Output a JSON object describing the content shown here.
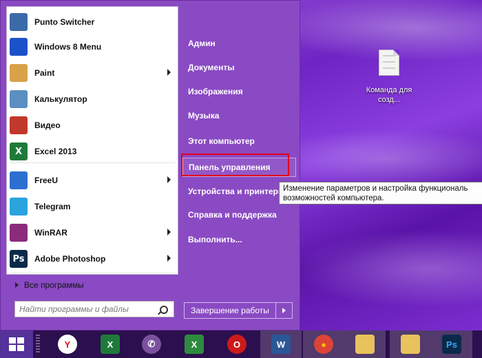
{
  "desktop": {
    "file_icon": "text-file-icon",
    "file_label": "Команда для созд..."
  },
  "start_menu": {
    "programs": [
      {
        "label": "Punto Switcher",
        "icon": "punto-switcher-icon",
        "color": "#3a6aa8",
        "glyph": "",
        "submenu": false
      },
      {
        "label": "Windows 8 Menu",
        "icon": "windows8-menu-icon",
        "color": "#1b52c9",
        "glyph": "",
        "submenu": false
      },
      {
        "label": "Paint",
        "icon": "paint-palette-icon",
        "color": "#d9a24a",
        "glyph": "",
        "submenu": true
      },
      {
        "label": "Калькулятор",
        "icon": "calculator-icon",
        "color": "#5a8fc0",
        "glyph": "",
        "submenu": false
      },
      {
        "label": "Видео",
        "icon": "video-icon",
        "color": "#c0392b",
        "glyph": "",
        "submenu": false
      },
      {
        "label": "Excel 2013",
        "icon": "excel-icon",
        "color": "#1f7a3a",
        "glyph": "X",
        "submenu": false
      },
      {
        "label": "FreeU",
        "icon": "freeu-icon",
        "color": "#2d6fd1",
        "glyph": "",
        "submenu": true
      },
      {
        "label": "Telegram",
        "icon": "telegram-icon",
        "color": "#2aa3df",
        "glyph": "",
        "submenu": false
      },
      {
        "label": "WinRAR",
        "icon": "winrar-icon",
        "color": "#8b2b7b",
        "glyph": "",
        "submenu": true
      },
      {
        "label": "Adobe Photoshop",
        "icon": "photoshop-icon",
        "color": "#0b2a4a",
        "glyph": "Ps",
        "submenu": true
      }
    ],
    "all_programs_label": "Все программы",
    "search_placeholder": "Найти программы и файлы",
    "right_items": [
      {
        "label": "Админ",
        "name": "admin"
      },
      {
        "label": "Документы",
        "name": "documents"
      },
      {
        "label": "Изображения",
        "name": "pictures"
      },
      {
        "label": "Музыка",
        "name": "music"
      },
      {
        "label": "Этот компьютер",
        "name": "this-pc"
      },
      {
        "label": "Панель управления",
        "name": "control-panel"
      },
      {
        "label": "Устройства и принтеры",
        "name": "devices-printers"
      },
      {
        "label": "Справка и поддержка",
        "name": "help-support"
      },
      {
        "label": "Выполнить...",
        "name": "run"
      }
    ],
    "highlighted_item": "Панель управления",
    "tooltip_line1": "Изменение параметров и настройка функциональ",
    "tooltip_line2": "возможностей компьютера.",
    "shutdown_label": "Завершение работы"
  },
  "taskbar": {
    "start_icon": "windows-logo-icon",
    "apps": [
      {
        "name": "yandex-browser",
        "icon": "yandex-browser-icon",
        "color": "#ffffff",
        "glyph": "Y",
        "glyph_color": "#e3001b"
      },
      {
        "name": "excel",
        "icon": "excel-icon",
        "color": "#1f7a3a",
        "glyph": "X",
        "glyph_color": "#ffffff"
      },
      {
        "name": "viber",
        "icon": "viber-icon",
        "color": "#7b519d",
        "glyph": "✆",
        "glyph_color": "#ffffff"
      },
      {
        "name": "excel-2",
        "icon": "excel-icon",
        "color": "#2e8b3e",
        "glyph": "X",
        "glyph_color": "#ffffff"
      },
      {
        "name": "opera",
        "icon": "opera-icon",
        "color": "#cc1b1b",
        "glyph": "O",
        "glyph_color": "#ffffff"
      },
      {
        "name": "word",
        "icon": "word-icon",
        "color": "#2b5797",
        "glyph": "W",
        "glyph_color": "#ffffff"
      },
      {
        "name": "chrome",
        "icon": "chrome-icon",
        "color": "#db4437",
        "glyph": "●",
        "glyph_color": "#fbbc05"
      },
      {
        "name": "file-explorer",
        "icon": "folder-icon",
        "color": "#e8c25c",
        "glyph": "",
        "glyph_color": "#ffffff"
      },
      {
        "name": "file-explorer-2",
        "icon": "folder-icon",
        "color": "#e8c25c",
        "glyph": "",
        "glyph_color": "#ffffff"
      },
      {
        "name": "photoshop",
        "icon": "photoshop-icon",
        "color": "#0b2a4a",
        "glyph": "Ps",
        "glyph_color": "#31a8ff"
      }
    ]
  }
}
